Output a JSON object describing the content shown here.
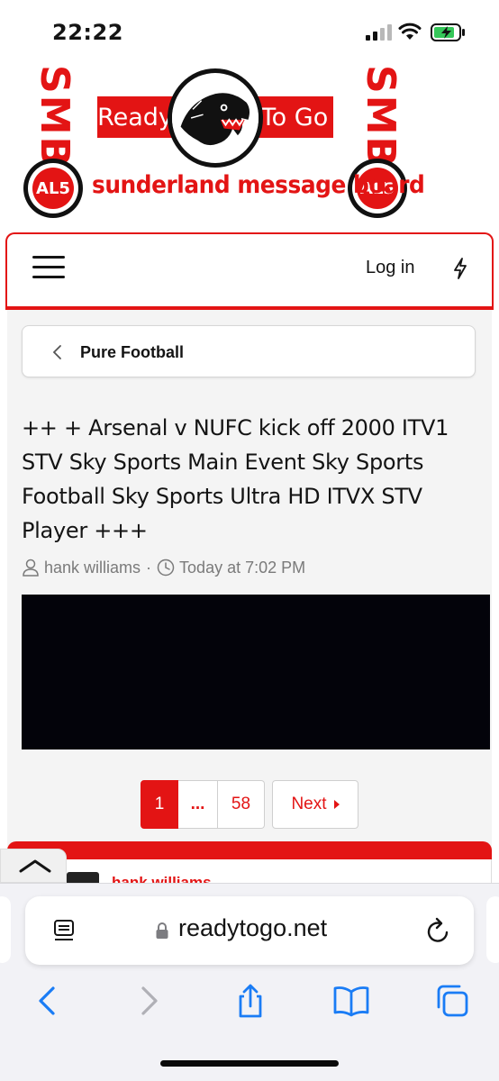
{
  "status_bar": {
    "time": "22:22"
  },
  "banner": {
    "smb": "SMB",
    "al15": "AL5",
    "left_word": "Ready",
    "right_word": "To Go",
    "tagline": "sunderland message board"
  },
  "nav": {
    "login": "Log in"
  },
  "breadcrumb": {
    "label": "Pure Football"
  },
  "thread": {
    "title": "++ + Arsenal v NUFC kick off 2000 ITV1 STV Sky Sports Main Event Sky Sports Football Sky Sports Ultra HD ITVX STV Player +++",
    "author": "hank williams",
    "separator": "·",
    "time": "Today at 7:02 PM"
  },
  "pagination": {
    "current": "1",
    "ellipsis": "...",
    "last": "58",
    "next": "Next"
  },
  "post": {
    "author_partial": "hank williams"
  },
  "safari": {
    "url": "readytogo.net"
  },
  "colors": {
    "accent": "#e31414",
    "ios_blue": "#1a7cf5"
  },
  "icons": [
    "signal-icon",
    "wifi-icon",
    "battery-charging-icon",
    "hamburger-icon",
    "bolt-icon",
    "chevron-left-icon",
    "user-icon",
    "clock-icon",
    "chevron-up-icon",
    "reader-icon",
    "lock-icon",
    "reload-icon",
    "back-icon",
    "forward-icon",
    "share-icon",
    "bookmarks-icon",
    "tabs-icon"
  ]
}
